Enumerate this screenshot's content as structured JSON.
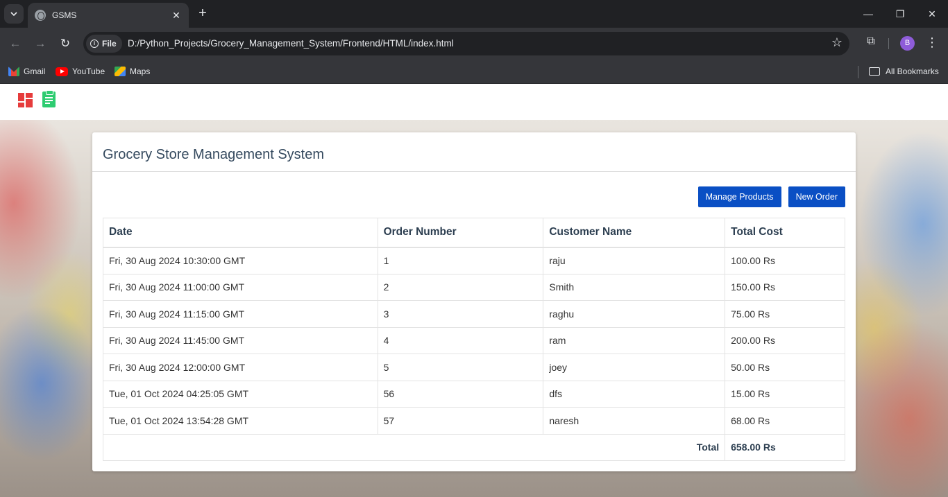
{
  "browser": {
    "tab_title": "GSMS",
    "omnibox_chip": "File",
    "url": "D:/Python_Projects/Grocery_Management_System/Frontend/HTML/index.html",
    "profile_initial": "B",
    "bookmarks": [
      "Gmail",
      "YouTube",
      "Maps"
    ],
    "all_bookmarks": "All Bookmarks"
  },
  "navbar": {
    "icons": [
      "dashboard-icon",
      "clipboard-icon"
    ]
  },
  "card": {
    "title": "Grocery Store Management System",
    "manage_products": "Manage Products",
    "new_order": "New Order"
  },
  "table": {
    "headers": [
      "Date",
      "Order Number",
      "Customer Name",
      "Total Cost"
    ],
    "rows": [
      [
        "Fri, 30 Aug 2024 10:30:00 GMT",
        "1",
        "raju",
        "100.00 Rs"
      ],
      [
        "Fri, 30 Aug 2024 11:00:00 GMT",
        "2",
        "Smith",
        "150.00 Rs"
      ],
      [
        "Fri, 30 Aug 2024 11:15:00 GMT",
        "3",
        "raghu",
        "75.00 Rs"
      ],
      [
        "Fri, 30 Aug 2024 11:45:00 GMT",
        "4",
        "ram",
        "200.00 Rs"
      ],
      [
        "Fri, 30 Aug 2024 12:00:00 GMT",
        "5",
        "joey",
        "50.00 Rs"
      ],
      [
        "Tue, 01 Oct 2024 04:25:05 GMT",
        "56",
        "dfs",
        "15.00 Rs"
      ],
      [
        "Tue, 01 Oct 2024 13:54:28 GMT",
        "57",
        "naresh",
        "68.00 Rs"
      ]
    ],
    "total_label": "Total",
    "total_value": "658.00 Rs"
  },
  "colors": {
    "primary_button": "#0a4fc4",
    "dashboard_icon": "#e63b3b",
    "order_icon": "#2ecc71",
    "title_text": "#34495e"
  }
}
